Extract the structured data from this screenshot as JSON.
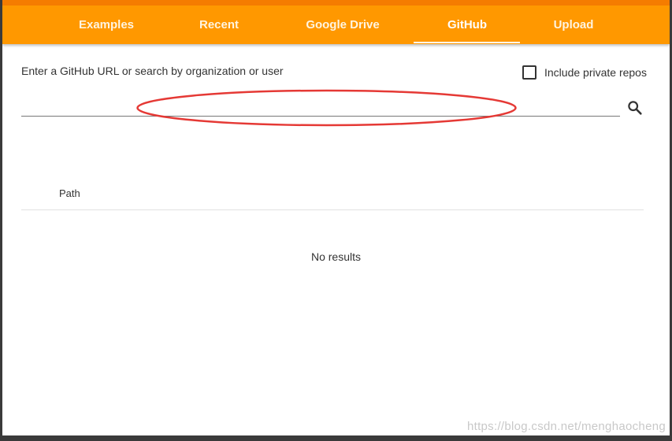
{
  "tabs": [
    {
      "label": "Examples"
    },
    {
      "label": "Recent"
    },
    {
      "label": "Google Drive"
    },
    {
      "label": "GitHub",
      "active": true
    },
    {
      "label": "Upload"
    }
  ],
  "github": {
    "prompt": "Enter a GitHub URL or search by organization or user",
    "include_private_label": "Include private repos",
    "include_private_checked": false,
    "search_value": "",
    "search_icon": "search-icon"
  },
  "results": {
    "column_path": "Path",
    "empty_text": "No results"
  },
  "annotation": {
    "color": "#e53935"
  },
  "watermark": "https://blog.csdn.net/menghaocheng",
  "colors": {
    "tabbar": "#ff9800",
    "tabbar_top": "#f57c00",
    "tab_text": "#ffffff"
  }
}
